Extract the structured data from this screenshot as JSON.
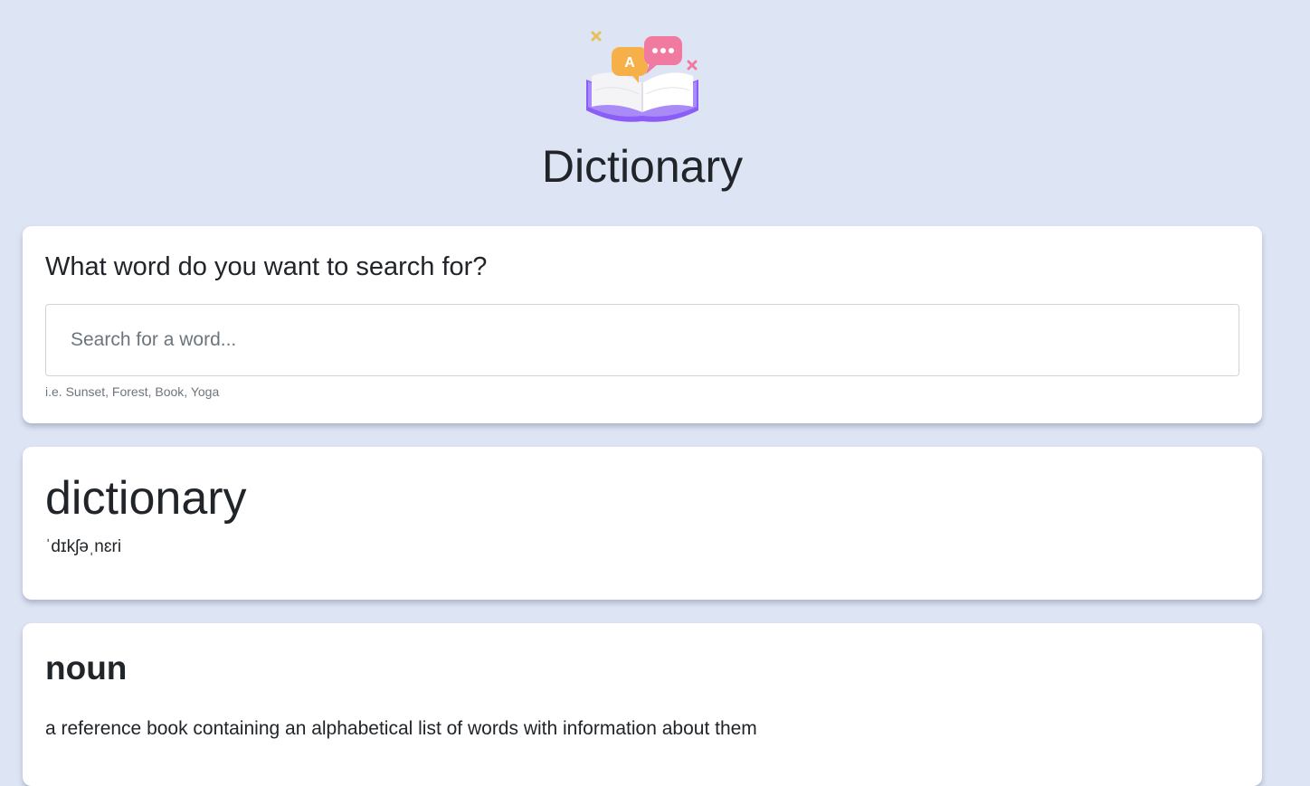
{
  "header": {
    "logo_bubble_letter": "A",
    "title": "Dictionary"
  },
  "search": {
    "heading": "What word do you want to search for?",
    "placeholder": "Search for a word...",
    "value": "",
    "hint": "i.e. Sunset, Forest, Book, Yoga"
  },
  "result": {
    "word": "dictionary",
    "phonetic": "ˈdɪkʃəˌnɛri",
    "meanings": [
      {
        "part_of_speech": "noun",
        "definition": "a reference book containing an alphabetical list of words with information about them"
      }
    ]
  },
  "colors": {
    "background": "#dde4f4",
    "card": "#ffffff",
    "text": "#212529",
    "muted": "#6c757d",
    "book_cover": "#8b5cf6",
    "bubble_orange": "#f5b04a",
    "bubble_pink": "#f07aa0"
  },
  "icons": {
    "logo": "open-book-with-speech-bubbles-icon"
  }
}
